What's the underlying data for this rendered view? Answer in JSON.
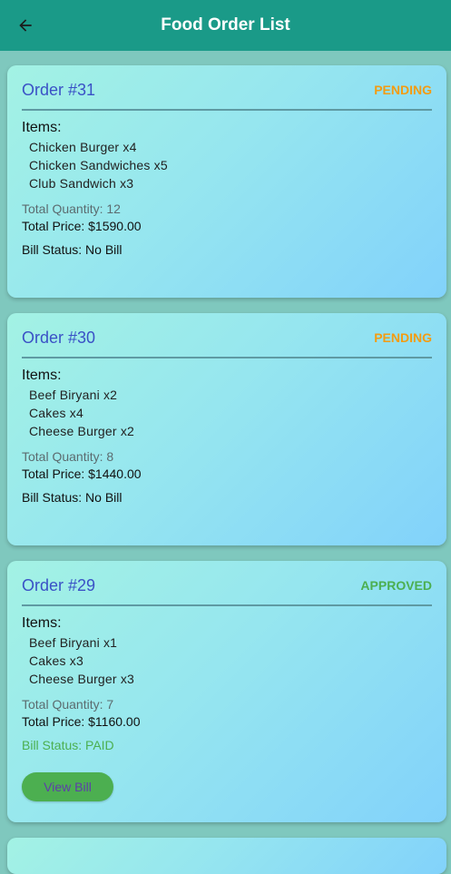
{
  "appbar": {
    "title": "Food Order List"
  },
  "orders": [
    {
      "label": "Order #31",
      "status": "PENDING",
      "items_label": "Items:",
      "items": [
        "Chicken Burger x4",
        "Chicken Sandwiches x5",
        "Club Sandwich x3"
      ],
      "total_quantity": "Total Quantity: 12",
      "total_price": "Total Price: $1590.00",
      "bill_status": "Bill Status: No Bill"
    },
    {
      "label": "Order #30",
      "status": "PENDING",
      "items_label": "Items:",
      "items": [
        "Beef Biryani x2",
        "Cakes x4",
        "Cheese Burger x2"
      ],
      "total_quantity": "Total Quantity: 8",
      "total_price": "Total Price: $1440.00",
      "bill_status": "Bill Status: No Bill"
    },
    {
      "label": "Order #29",
      "status": "APPROVED",
      "items_label": "Items:",
      "items": [
        "Beef Biryani x1",
        "Cakes x3",
        "Cheese Burger x3"
      ],
      "total_quantity": "Total Quantity: 7",
      "total_price": "Total Price: $1160.00",
      "bill_status": "Bill Status: PAID",
      "view_bill_label": "View Bill"
    }
  ],
  "colors": {
    "appbar": "#1a9a88",
    "pending": "#f39c12",
    "approved": "#4caf50",
    "order_title": "#3a51c6"
  }
}
